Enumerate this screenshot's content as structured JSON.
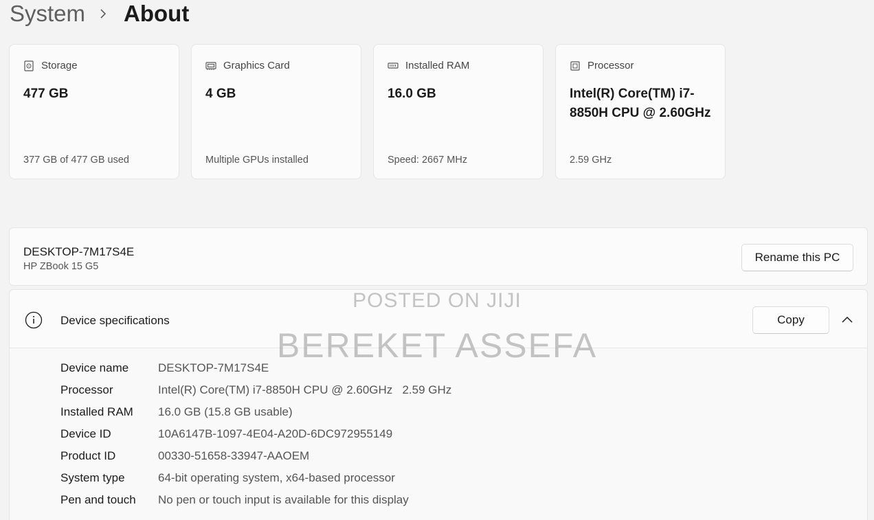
{
  "breadcrumb": {
    "parent": "System",
    "separator": "›",
    "current": "About"
  },
  "cards": [
    {
      "icon": "storage-icon",
      "label": "Storage",
      "value": "477 GB",
      "sub": "377 GB of 477 GB used"
    },
    {
      "icon": "graphics-card-icon",
      "label": "Graphics Card",
      "value": "4 GB",
      "sub": "Multiple GPUs installed"
    },
    {
      "icon": "ram-icon",
      "label": "Installed RAM",
      "value": "16.0 GB",
      "sub": "Speed: 2667 MHz"
    },
    {
      "icon": "processor-icon",
      "label": "Processor",
      "value": "Intel(R) Core(TM) i7-8850H CPU @ 2.60GHz",
      "sub": "2.59 GHz"
    }
  ],
  "pc": {
    "name": "DESKTOP-7M17S4E",
    "model": "HP ZBook 15 G5",
    "rename_label": "Rename this PC"
  },
  "specs": {
    "title": "Device specifications",
    "copy_label": "Copy",
    "rows": [
      {
        "label": "Device name",
        "value": "DESKTOP-7M17S4E"
      },
      {
        "label": "Processor",
        "value": "Intel(R) Core(TM) i7-8850H CPU @ 2.60GHz   2.59 GHz"
      },
      {
        "label": "Installed RAM",
        "value": "16.0 GB (15.8 GB usable)"
      },
      {
        "label": "Device ID",
        "value": "10A6147B-1097-4E04-A20D-6DC972955149"
      },
      {
        "label": "Product ID",
        "value": "00330-51658-33947-AAOEM"
      },
      {
        "label": "System type",
        "value": "64-bit operating system, x64-based processor"
      },
      {
        "label": "Pen and touch",
        "value": "No pen or touch input is available for this display"
      }
    ]
  },
  "watermark": {
    "line1": "POSTED ON JIJI",
    "line2": "BEREKET ASSEFA"
  }
}
